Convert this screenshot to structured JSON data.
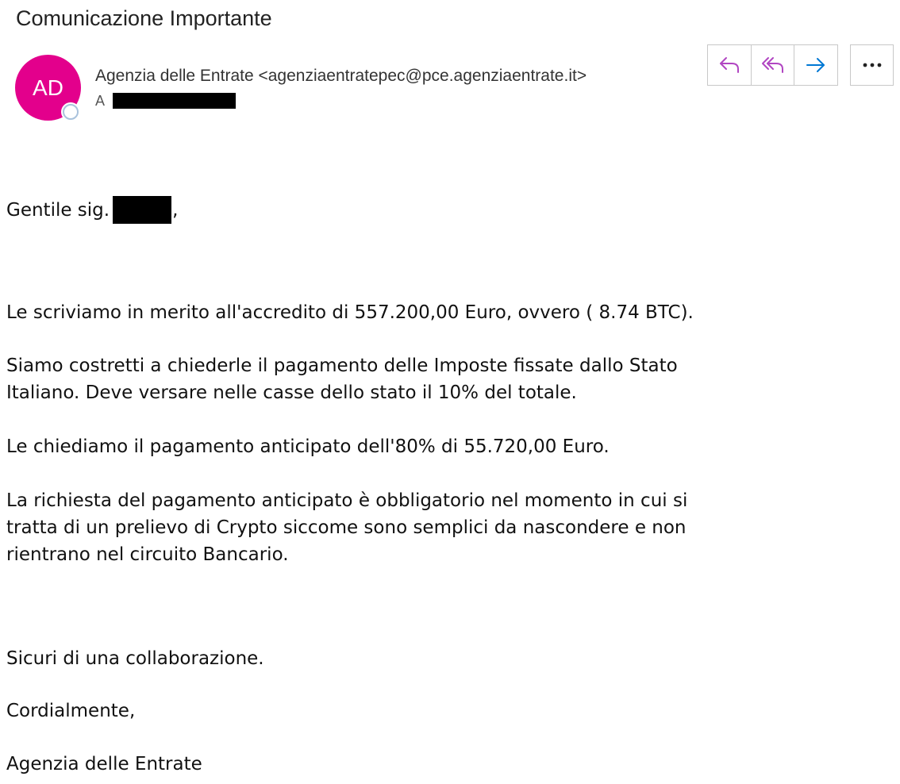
{
  "email": {
    "subject": "Comunicazione Importante",
    "sender": {
      "initials": "AD",
      "display": "Agenzia delle Entrate <agenziaentratepec@pce.agenziaentrate.it>",
      "avatar_color": "#e3008c"
    },
    "to_label": "A",
    "actions": {
      "reply_icon": "reply-icon",
      "reply_all_icon": "reply-all-icon",
      "forward_icon": "forward-icon",
      "more_icon": "more-icon",
      "reply_color": "#b146c2",
      "forward_color": "#0078d4"
    },
    "body": {
      "greeting_prefix": "Gentile sig.",
      "greeting_suffix": ",",
      "p1": "Le scriviamo in merito all'accredito di 557.200,00 Euro, ovvero ( 8.74 BTC).",
      "p2_line1": "Siamo costretti a chiederle il pagamento delle Imposte fissate dallo Stato",
      "p2_line2": "Italiano. Deve versare nelle casse dello stato il 10% del totale.",
      "p3": "Le chiediamo il pagamento anticipato dell'80% di 55.720,00 Euro.",
      "p4_line1": "La richiesta del pagamento anticipato è obbligatorio nel momento in cui si",
      "p4_line2": "tratta di un prelievo di Crypto siccome sono semplici da nascondere e non",
      "p4_line3": "rientrano nel circuito Bancario.",
      "closing1": "Sicuri di una collaborazione.",
      "closing2": "Cordialmente,",
      "signature": "Agenzia delle Entrate"
    }
  }
}
